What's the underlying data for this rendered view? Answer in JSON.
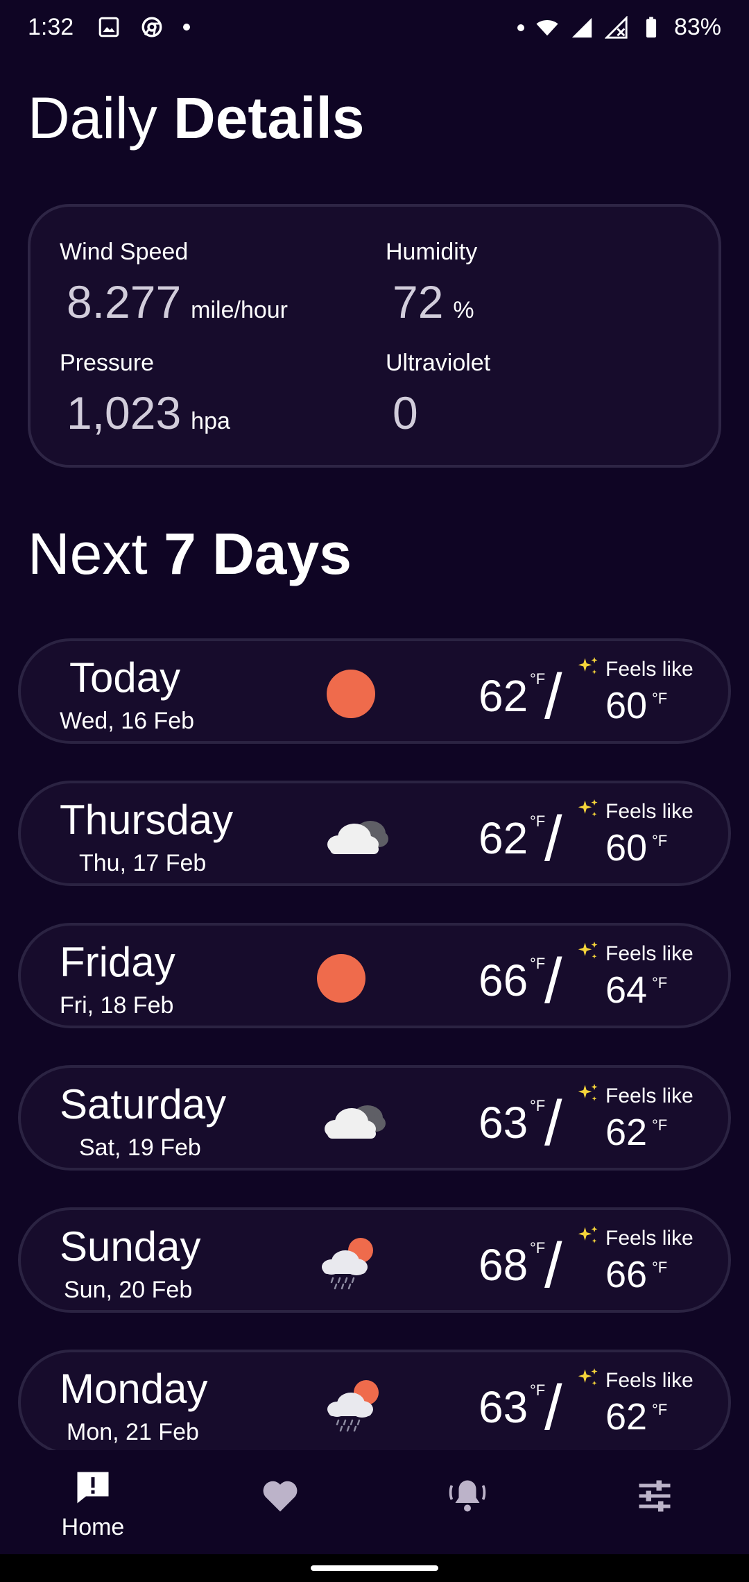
{
  "status": {
    "time": "1:32",
    "battery": "83%"
  },
  "header": {
    "title_light": "Daily",
    "title_bold": "Details"
  },
  "details": {
    "wind": {
      "label": "Wind Speed",
      "value": "8.277",
      "unit": "mile/hour"
    },
    "humidity": {
      "label": "Humidity",
      "value": "72",
      "unit": "%"
    },
    "pressure": {
      "label": "Pressure",
      "value": "1,023",
      "unit": "hpa"
    },
    "uv": {
      "label": "Ultraviolet",
      "value": "0",
      "unit": ""
    }
  },
  "next": {
    "title_light": "Next",
    "title_bold": "7 Days"
  },
  "days": [
    {
      "name": "Today",
      "date": "Wed, 16 Feb",
      "icon": "sun-icon",
      "temp": "62",
      "unit": "°F",
      "feels_label": "Feels like",
      "feels": "60"
    },
    {
      "name": "Thursday",
      "date": "Thu, 17 Feb",
      "icon": "cloudy-icon",
      "temp": "62",
      "unit": "°F",
      "feels_label": "Feels like",
      "feels": "60"
    },
    {
      "name": "Friday",
      "date": "Fri, 18 Feb",
      "icon": "sun-icon",
      "temp": "66",
      "unit": "°F",
      "feels_label": "Feels like",
      "feels": "64"
    },
    {
      "name": "Saturday",
      "date": "Sat, 19 Feb",
      "icon": "cloudy-icon",
      "temp": "63",
      "unit": "°F",
      "feels_label": "Feels like",
      "feels": "62"
    },
    {
      "name": "Sunday",
      "date": "Sun, 20 Feb",
      "icon": "rain-sun-icon",
      "temp": "68",
      "unit": "°F",
      "feels_label": "Feels like",
      "feels": "66"
    },
    {
      "name": "Monday",
      "date": "Mon, 21 Feb",
      "icon": "rain-sun-icon",
      "temp": "63",
      "unit": "°F",
      "feels_label": "Feels like",
      "feels": "62"
    }
  ],
  "nav": {
    "home": "Home"
  },
  "colors": {
    "background": "#0f0524",
    "card": "#170c2c",
    "sun": "#ef6b4c",
    "sparkle": "#f5d43a"
  }
}
